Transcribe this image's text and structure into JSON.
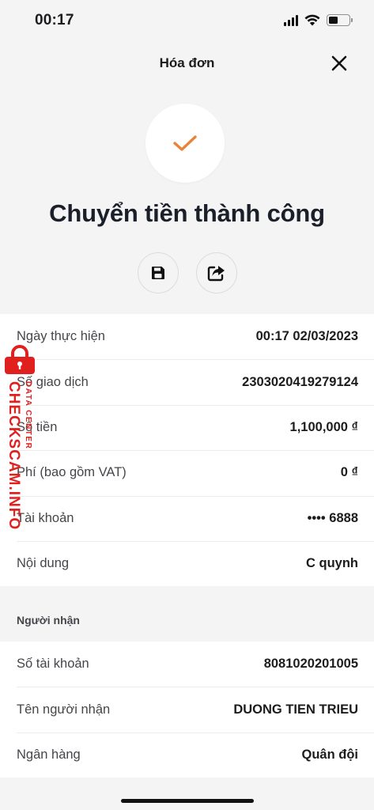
{
  "status_bar": {
    "time": "00:17",
    "battery_level": 0.45
  },
  "header": {
    "title": "Hóa đơn"
  },
  "success": {
    "title": "Chuyển tiền thành công"
  },
  "icons": {
    "check": "check-icon",
    "save": "floppy-disk-icon",
    "share": "share-icon",
    "close": "close-icon"
  },
  "colors": {
    "accent": "#e8843a",
    "background": "#f4f4f5",
    "text": "#1c1c1e",
    "watermark": "#e0201e"
  },
  "transaction": {
    "rows": [
      {
        "label": "Ngày thực hiện",
        "value": "00:17 02/03/2023"
      },
      {
        "label": "Số giao dịch",
        "value": "2303020419279124"
      },
      {
        "label": "Số tiền",
        "value": "1,100,000 ₫"
      },
      {
        "label": "Phí (bao gồm VAT)",
        "value": "0 ₫"
      },
      {
        "label": "Tài khoản",
        "value": "•••• 6888"
      },
      {
        "label": "Nội dung",
        "value": "C quynh"
      }
    ]
  },
  "recipient": {
    "section_label": "Người nhận",
    "rows": [
      {
        "label": "Số tài khoản",
        "value": "8081020201005"
      },
      {
        "label": "Tên người nhận",
        "value": "DUONG TIEN TRIEU"
      },
      {
        "label": "Ngân hàng",
        "value": "Quân đội"
      }
    ]
  },
  "watermark": {
    "main": "CHECKSCAM.INFO",
    "sub": "DATA CENTER"
  }
}
